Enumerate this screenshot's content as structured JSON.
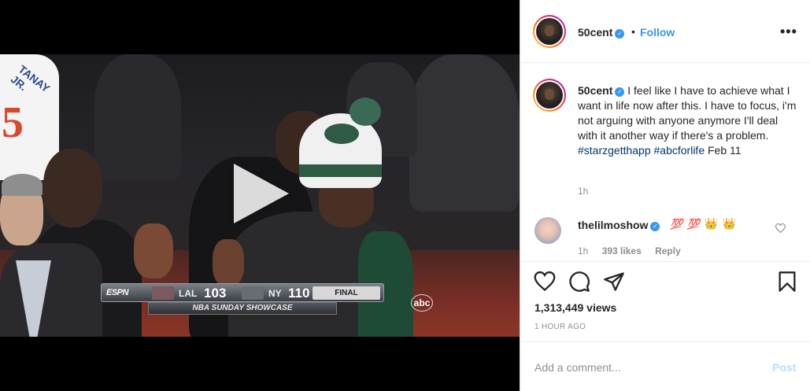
{
  "post": {
    "username": "50cent",
    "follow_label": "Follow",
    "separator": "•",
    "more_label": "•••"
  },
  "caption": {
    "username": "50cent",
    "text": " I feel like I have to achieve what I want in life now after this. I have to focus, i'm not arguing with anyone anymore I'll deal with it another way if there's a problem. ",
    "hashtag1": "#starzgetthapp",
    "hashtag2": "#abcforlife",
    "date": " Feb 11",
    "time": "1h"
  },
  "comment": {
    "username": "thelilmoshow",
    "emojis": [
      "💯",
      "💯",
      "👑",
      "👑"
    ],
    "time": "1h",
    "likes": "393 likes",
    "reply_label": "Reply"
  },
  "stats": {
    "views": "1,313,449 views",
    "time_ago": "1 HOUR AGO"
  },
  "comment_box": {
    "placeholder": "Add a comment...",
    "post_label": "Post"
  },
  "video": {
    "scoreboard": {
      "network": "ESPN",
      "team1": "LAL",
      "score1": "103",
      "team2": "NY",
      "score2": "110",
      "status": "FINAL",
      "show": "NBA SUNDAY SHOWCASE"
    },
    "jersey_name": "TANAY JR.",
    "jersey_number": "5",
    "channel_bug": "abc"
  },
  "colors": {
    "accent": "#3897f0",
    "post_disabled": "#b2dffc",
    "hashtag": "#003569"
  }
}
